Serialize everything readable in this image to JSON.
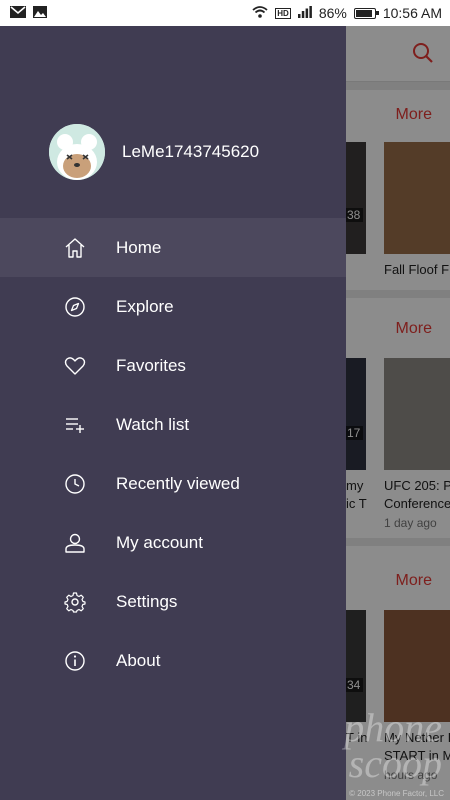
{
  "status_bar": {
    "battery": "86%",
    "time": "10:56 AM",
    "icons": [
      "gmail-icon",
      "image-icon",
      "wifi-icon",
      "hd-icon",
      "signal-icon",
      "battery-icon"
    ]
  },
  "background": {
    "sections": [
      {
        "more_label": "More",
        "videos": [
          {
            "title": "",
            "duration": "38"
          },
          {
            "title": "Fall Floof F",
            "time": ""
          }
        ]
      },
      {
        "more_label": "More",
        "videos": [
          {
            "title": "my",
            "subtitle": "ic T",
            "duration": "17"
          },
          {
            "title": "UFC 205: P",
            "subtitle": "Conference",
            "time": "1 day ago"
          }
        ]
      },
      {
        "more_label": "More",
        "videos": [
          {
            "title": "T in",
            "duration": "34"
          },
          {
            "title": "My Nether I",
            "subtitle": "START in M",
            "time": "hours ago"
          }
        ]
      }
    ]
  },
  "drawer": {
    "username": "LeMe1743745620",
    "menu": [
      {
        "label": "Home",
        "icon": "home-icon",
        "active": true
      },
      {
        "label": "Explore",
        "icon": "compass-icon",
        "active": false
      },
      {
        "label": "Favorites",
        "icon": "heart-icon",
        "active": false
      },
      {
        "label": "Watch list",
        "icon": "playlist-add-icon",
        "active": false
      },
      {
        "label": "Recently viewed",
        "icon": "clock-icon",
        "active": false
      },
      {
        "label": "My account",
        "icon": "person-icon",
        "active": false
      },
      {
        "label": "Settings",
        "icon": "gear-icon",
        "active": false
      },
      {
        "label": "About",
        "icon": "info-icon",
        "active": false
      }
    ]
  },
  "watermark": {
    "text": "phone\nscoop",
    "copyright": "© 2023 Phone Factor, LLC"
  },
  "colors": {
    "drawer_bg": "#403c52",
    "accent": "#e53935"
  }
}
